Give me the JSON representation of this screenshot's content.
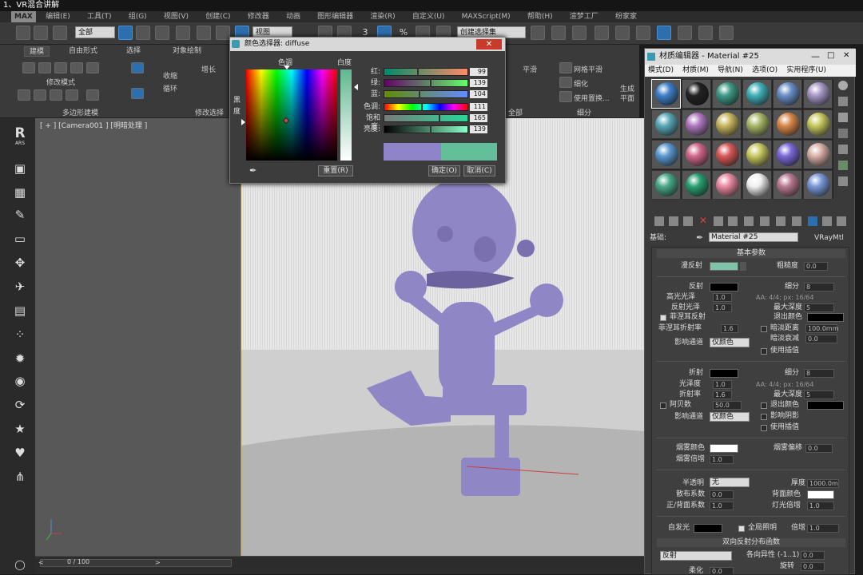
{
  "window": {
    "title": "1、VR混合讲解"
  },
  "menubar": {
    "logo": "MAX",
    "items": [
      "编辑(E)",
      "工具(T)",
      "组(G)",
      "视图(V)",
      "创建(C)",
      "修改器",
      "动画",
      "图形编辑器",
      "渲染(R)",
      "自定义(U)",
      "MAXScript(M)",
      "帮助(H)",
      "渲梦工厂",
      "纷家家"
    ]
  },
  "toolbar": {
    "filter_select": "全部",
    "view_select": "视图",
    "selection_set": "创建选择集",
    "num3": "3",
    "percent": "%"
  },
  "ribbon": {
    "tabs": [
      "建模",
      "自由形式",
      "选择",
      "对象绘制"
    ],
    "modify_mode": "修改模式",
    "poly_model": "多边形建模",
    "modify_select": "修改选择",
    "grow": "增长",
    "shrink": "收缩",
    "loop": "循环",
    "ring": "环",
    "all": "全部",
    "mesh_smooth": "网格平滑",
    "refine": "细化",
    "use_replace": "使用置换...",
    "subdivide": "细分",
    "gen_plane": "生成平面"
  },
  "sidebar": {
    "r_logo": "R",
    "r_sub": "ARS"
  },
  "viewport": {
    "label": "[ + ] [Camera001 ] [明暗处理 ]"
  },
  "timeline": {
    "frame": "0 / 100"
  },
  "color_selector": {
    "title": "颜色选择器: diffuse",
    "hue_label": "色调",
    "white_label": "白度",
    "black_label": "黑度",
    "channels": [
      {
        "label": "红:",
        "value": "99",
        "fill": 0.39
      },
      {
        "label": "绿:",
        "value": "139",
        "fill": 0.55
      },
      {
        "label": "蓝:",
        "value": "104",
        "fill": 0.41
      },
      {
        "label": "色调:",
        "value": "111",
        "fill": 0.44
      },
      {
        "label": "饱和度:",
        "value": "165",
        "fill": 0.65
      },
      {
        "label": "亮度:",
        "value": "139",
        "fill": 0.55
      }
    ],
    "reset_button": "重置(R)",
    "ok_button": "确定(O)",
    "cancel_button": "取消(C)",
    "old_color": "#8f83c9",
    "new_color": "#63bf9a"
  },
  "material_editor": {
    "title": "材质编辑器 - Material #25",
    "menu": [
      "模式(D)",
      "材质(M)",
      "导航(N)",
      "选项(O)",
      "实用程序(U)"
    ],
    "base_label": "基础:",
    "material_name": "Material #25",
    "material_type": "VRayMtl",
    "rollout_basic": "基本参数",
    "diffuse_label": "漫反射",
    "roughness_label": "粗糙度",
    "roughness": "0.0",
    "reflect": "反射",
    "subdiv_label": "细分",
    "subdiv": "8",
    "hilight_gloss": "高光光泽",
    "hilight_gloss_val": "1.0",
    "aa_info": "AA: 4/4; px: 16/64",
    "refl_gloss": "反射光泽",
    "refl_gloss_val": "1.0",
    "max_depth": "最大深度",
    "max_depth_val": "5",
    "fresnel": "菲涅耳反射",
    "exit_color": "退出颜色",
    "fresnel_ior": "菲涅耳折射率",
    "fresnel_ior_val": "1.6",
    "dim_distance": "暗淡距离",
    "dim_distance_val": "100.0mm",
    "dim_falloff": "暗淡衰减",
    "dim_falloff_val": "0.0",
    "affect_channel": "影响通道",
    "color_only": "仅颜色",
    "use_interp": "使用插值",
    "refract": "折射",
    "glossiness": "光泽度",
    "glossiness_val": "1.0",
    "ior": "折射率",
    "ior_val": "1.6",
    "abbe": "阿贝数",
    "abbe_val": "50.0",
    "affect_shadows": "影响阴影",
    "fog_color": "烟雾颜色",
    "fog_bias": "烟雾偏移",
    "fog_bias_val": "0.0",
    "fog_multiplier": "烟雾倍增",
    "fog_multiplier_val": "1.0",
    "translucency": "半透明",
    "translucency_val": "无",
    "thickness": "厚度",
    "thickness_val": "1000.0m",
    "scatter_coeff": "散布系数",
    "scatter_val": "0.0",
    "back_color": "背面颜色",
    "fb_coeff": "正/背面系数",
    "fb_val": "1.0",
    "light_mult": "灯光倍增",
    "light_mult_val": "1.0",
    "self_illum": "自发光",
    "gi": "全局照明",
    "multiplier": "倍增",
    "multiplier_val": "1.0",
    "brdf": "双向反射分布函数",
    "brdf_type": "反射",
    "anisotropy": "各向异性 (-1..1)",
    "anisotropy_val": "0.0",
    "rotation": "旋转",
    "rotation_val": "0.0",
    "soften": "柔化",
    "soften_val": "0.0",
    "diffuse_color": "#7fc3a9",
    "slots": [
      "#3f7fc8",
      "#222222",
      "#3f9a88",
      "#3fb0b8",
      "#6a8fc8",
      "#a898c8",
      "#5aa8b8",
      "#b078c0",
      "#c8b860",
      "#a8b868",
      "#d8884a",
      "#c8c860",
      "#5a98d0",
      "#d0688a",
      "#d85858",
      "#c8c860",
      "#7a68d8",
      "#d8b0a8",
      "#48a888",
      "#28a070",
      "#e888a0",
      "#f0f0f0",
      "#b87890",
      "#7898d8"
    ]
  },
  "colors": {
    "accent": "#2d6fae",
    "character": "#9088c8"
  }
}
